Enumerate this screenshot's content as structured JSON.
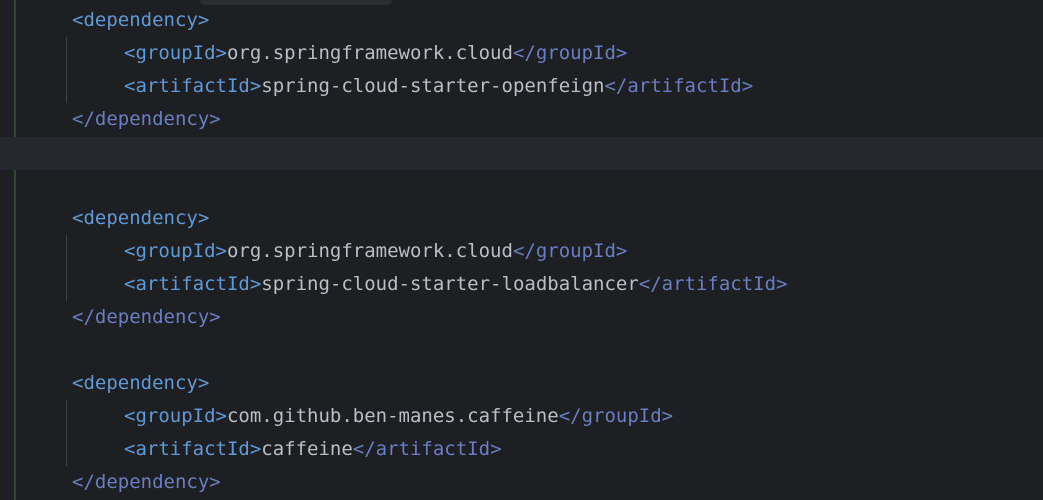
{
  "blocks": [
    {
      "open": "<dependency>",
      "group_open": "<groupId>",
      "group_value": "org.springframework.cloud",
      "group_close": "</groupId>",
      "artifact_open": "<artifactId>",
      "artifact_value": "spring-cloud-starter-openfeign",
      "artifact_close": "</artifactId>",
      "close": "</dependency>"
    },
    {
      "open": "<dependency>",
      "group_open": "<groupId>",
      "group_value": "org.springframework.cloud",
      "group_close": "</groupId>",
      "artifact_open": "<artifactId>",
      "artifact_value": "spring-cloud-starter-loadbalancer",
      "artifact_close": "</artifactId>",
      "close": "</dependency>"
    },
    {
      "open": "<dependency>",
      "group_open": "<groupId>",
      "group_value": "com.github.ben-manes.caffeine",
      "group_close": "</groupId>",
      "artifact_open": "<artifactId>",
      "artifact_value": "caffeine",
      "artifact_close": "</artifactId>",
      "close": "</dependency>"
    }
  ],
  "theme": {
    "background": "#1e1f22",
    "tag_color": "#5f9ad6",
    "closing_tag_color": "#6a7ec4",
    "text_color": "#bcbec4",
    "caret_line": "#26282e"
  }
}
